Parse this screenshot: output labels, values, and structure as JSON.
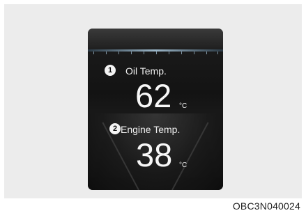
{
  "gauges": [
    {
      "marker": "1",
      "label": "Oil Temp.",
      "value": "62",
      "unit": "°C"
    },
    {
      "marker": "2",
      "label": "Engine Temp.",
      "value": "38",
      "unit": "°C"
    }
  ],
  "image_code": "OBC3N040024",
  "colors": {
    "screen_bg": "#151515",
    "text": "#f5f5f5",
    "accent_line": "#9bb6c8",
    "frame_bg": "#ececec"
  },
  "icons": {
    "marker_1": "number-1-circle-icon",
    "marker_2": "number-2-circle-icon"
  }
}
